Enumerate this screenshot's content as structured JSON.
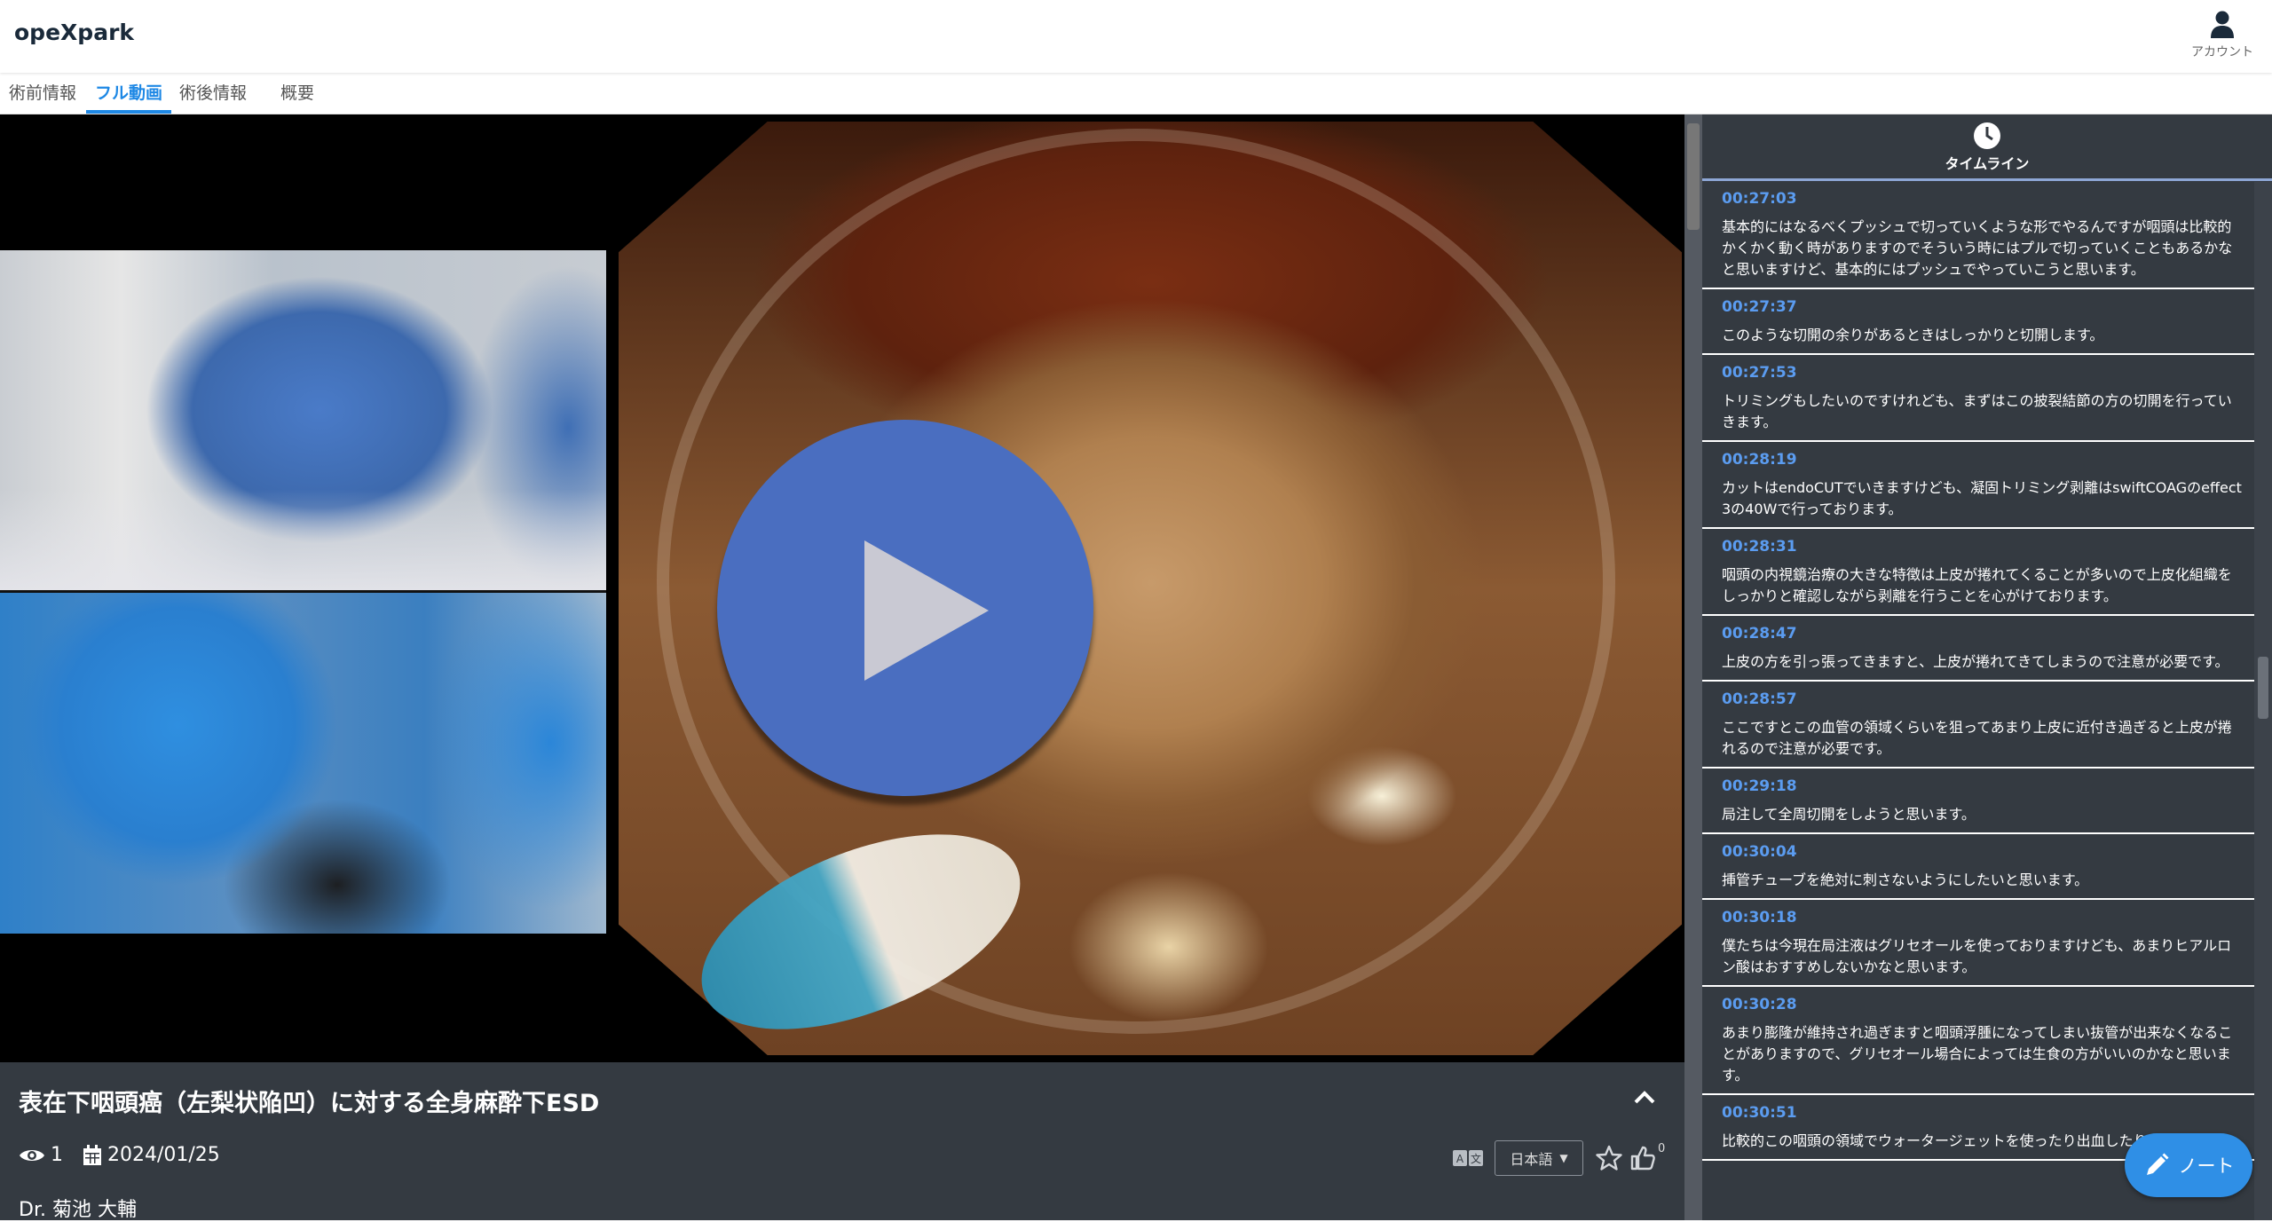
{
  "app": {
    "title": "opeXpark",
    "account_label": "アカウント"
  },
  "tabs": [
    {
      "label": "術前情報"
    },
    {
      "label": "フル動画"
    },
    {
      "label": "術後情報"
    },
    {
      "label": "概要"
    }
  ],
  "video": {
    "title": "表在下咽頭癌（左梨状陥凹）に対する全身麻酔下ESD",
    "views": "1",
    "date": "2024/01/25",
    "doctor": "Dr. 菊池 大輔",
    "language": "日本語",
    "likes": "0"
  },
  "timeline": {
    "header": "タイムライン",
    "items": [
      {
        "time": "00:27:03",
        "text": "基本的にはなるべくプッシュで切っていくような形でやるんですが咽頭は比較的かくかく動く時がありますのでそういう時にはプルで切っていくこともあるかなと思いますけど、基本的にはプッシュでやっていこうと思います。"
      },
      {
        "time": "00:27:37",
        "text": "このような切開の余りがあるときはしっかりと切開します。"
      },
      {
        "time": "00:27:53",
        "text": "トリミングもしたいのですけれども、まずはこの披裂結節の方の切開を行っていきます。"
      },
      {
        "time": "00:28:19",
        "text": "カットはendoCUTでいきますけども、凝固トリミング剥離はswiftCOAGのeffect 3の40Wで行っております。"
      },
      {
        "time": "00:28:31",
        "text": "咽頭の内視鏡治療の大きな特徴は上皮が捲れてくることが多いので上皮化組織をしっかりと確認しながら剥離を行うことを心がけております。"
      },
      {
        "time": "00:28:47",
        "text": "上皮の方を引っ張ってきますと、上皮が捲れてきてしまうので注意が必要です。"
      },
      {
        "time": "00:28:57",
        "text": "ここですとこの血管の領域くらいを狙ってあまり上皮に近付き過ぎると上皮が捲れるので注意が必要です。"
      },
      {
        "time": "00:29:18",
        "text": "局注して全周切開をしようと思います。"
      },
      {
        "time": "00:30:04",
        "text": "挿管チューブを絶対に刺さないようにしたいと思います。"
      },
      {
        "time": "00:30:18",
        "text": "僕たちは今現在局注液はグリセオールを使っておりますけども、あまりヒアルロン酸はおすすめしないかなと思います。"
      },
      {
        "time": "00:30:28",
        "text": "あまり膨隆が維持され過ぎますと咽頭浮腫になってしまい抜管が出来なくなることがありますので、グリセオール場合によっては生食の方がいいのかなと思います。"
      },
      {
        "time": "00:30:51",
        "text": "比較的この咽頭の領域でウォータージェットを使ったり出血したりことがありま"
      }
    ]
  },
  "note_button": {
    "label": "ノート"
  },
  "colors": {
    "accent": "#1e88e5",
    "panel": "#343a41",
    "timestamp": "#5b9cf0",
    "play": "#4a6ec0"
  },
  "icons": [
    "account-icon",
    "clock-icon",
    "eye-icon",
    "calendar-icon",
    "chevron-up-icon",
    "translate-icon",
    "star-icon",
    "thumbs-up-icon",
    "pencil-icon",
    "play-icon"
  ]
}
